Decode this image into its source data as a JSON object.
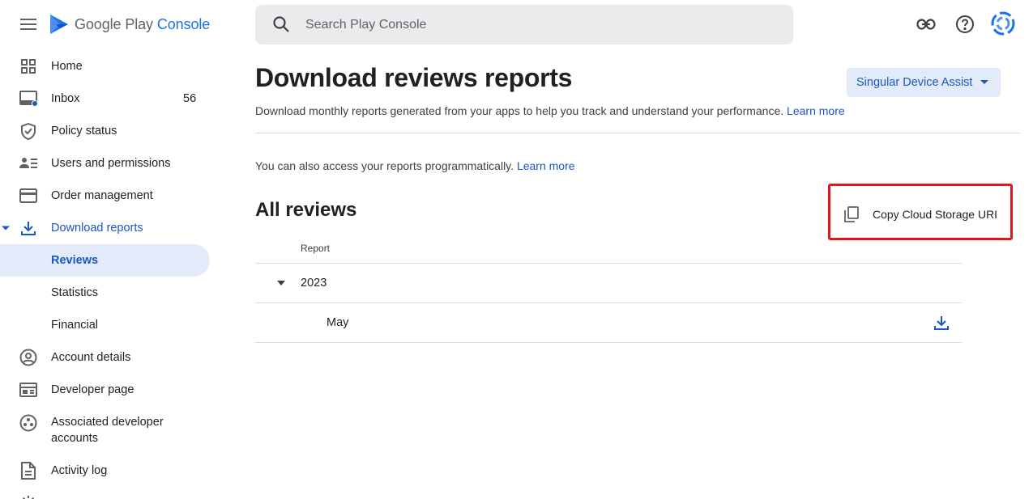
{
  "app": {
    "logo_text_main": "Google Play",
    "logo_text_accent": "Console"
  },
  "search": {
    "placeholder": "Search Play Console"
  },
  "sidebar": {
    "items": [
      {
        "label": "Home",
        "icon": "home-icon"
      },
      {
        "label": "Inbox",
        "icon": "inbox-icon",
        "count": "56"
      },
      {
        "label": "Policy status",
        "icon": "shield-icon"
      },
      {
        "label": "Users and permissions",
        "icon": "users-icon"
      },
      {
        "label": "Order management",
        "icon": "card-icon"
      },
      {
        "label": "Download reports",
        "icon": "download-icon"
      },
      {
        "label": "Reviews"
      },
      {
        "label": "Statistics"
      },
      {
        "label": "Financial"
      },
      {
        "label": "Account details",
        "icon": "account-icon"
      },
      {
        "label": "Developer page",
        "icon": "developer-page-icon"
      },
      {
        "label": "Associated developer accounts",
        "icon": "associated-accounts-icon"
      },
      {
        "label": "Activity log",
        "icon": "activity-log-icon"
      }
    ]
  },
  "main": {
    "title": "Download reviews reports",
    "app_selector": "Singular Device Assist",
    "description": "Download monthly reports generated from your apps to help you track and understand your performance.",
    "learn_more": "Learn more",
    "programmatic_note": "You can also access your reports programmatically.",
    "programmatic_learn_more": "Learn more",
    "section_title": "All reviews",
    "copy_button": "Copy Cloud Storage URI",
    "table": {
      "header": "Report",
      "year": "2023",
      "month": "May"
    }
  },
  "colors": {
    "accent": "#1a56c4",
    "selected_bg": "#e3ebfb",
    "highlight": "#e0161e"
  }
}
